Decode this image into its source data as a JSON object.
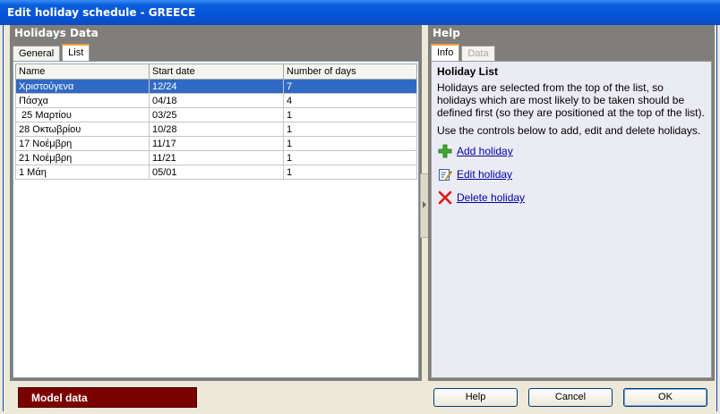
{
  "window": {
    "title": "Edit holiday schedule - GREECE"
  },
  "left_panel": {
    "title": "Holidays Data",
    "tabs": [
      {
        "label": "General",
        "active": false
      },
      {
        "label": "List",
        "active": true
      }
    ],
    "table": {
      "columns": [
        "Name",
        "Start date",
        "Number of days"
      ],
      "rows": [
        {
          "name": "Χριστούγενα",
          "start": "12/24",
          "days": "7",
          "selected": true
        },
        {
          "name": "Πάσχα",
          "start": "04/18",
          "days": "4",
          "selected": false
        },
        {
          "name": " 25 Μαρτίου",
          "start": "03/25",
          "days": "1",
          "selected": false
        },
        {
          "name": "28 Οκτωβρίου",
          "start": "10/28",
          "days": "1",
          "selected": false
        },
        {
          "name": "17 Νοέμβρη",
          "start": "11/17",
          "days": "1",
          "selected": false
        },
        {
          "name": "21 Νοέμβρη",
          "start": "11/21",
          "days": "1",
          "selected": false
        },
        {
          "name": "1 Μάη",
          "start": "05/01",
          "days": "1",
          "selected": false
        }
      ]
    }
  },
  "right_panel": {
    "title": "Help",
    "tabs": [
      {
        "label": "Info",
        "active": true
      },
      {
        "label": "Data",
        "active": false,
        "disabled": true
      }
    ],
    "heading": "Holiday List",
    "paragraphs": [
      "Holidays are selected from the top of the list, so holidays which are most likely to be taken should be defined first (so they are positioned at the top of the list).",
      "Use the controls below to add, edit and delete holidays."
    ],
    "actions": [
      {
        "label": "Add holiday",
        "icon": "add-icon"
      },
      {
        "label": "Edit holiday",
        "icon": "edit-icon"
      },
      {
        "label": "Delete holiday",
        "icon": "delete-icon"
      }
    ]
  },
  "footer": {
    "model_data_label": "Model data",
    "help_label": "Help",
    "cancel_label": "Cancel",
    "ok_label": "OK"
  },
  "colors": {
    "selection": "#316ac5",
    "panel": "#807e7a",
    "model_data": "#7b0000",
    "link": "#0000aa"
  }
}
